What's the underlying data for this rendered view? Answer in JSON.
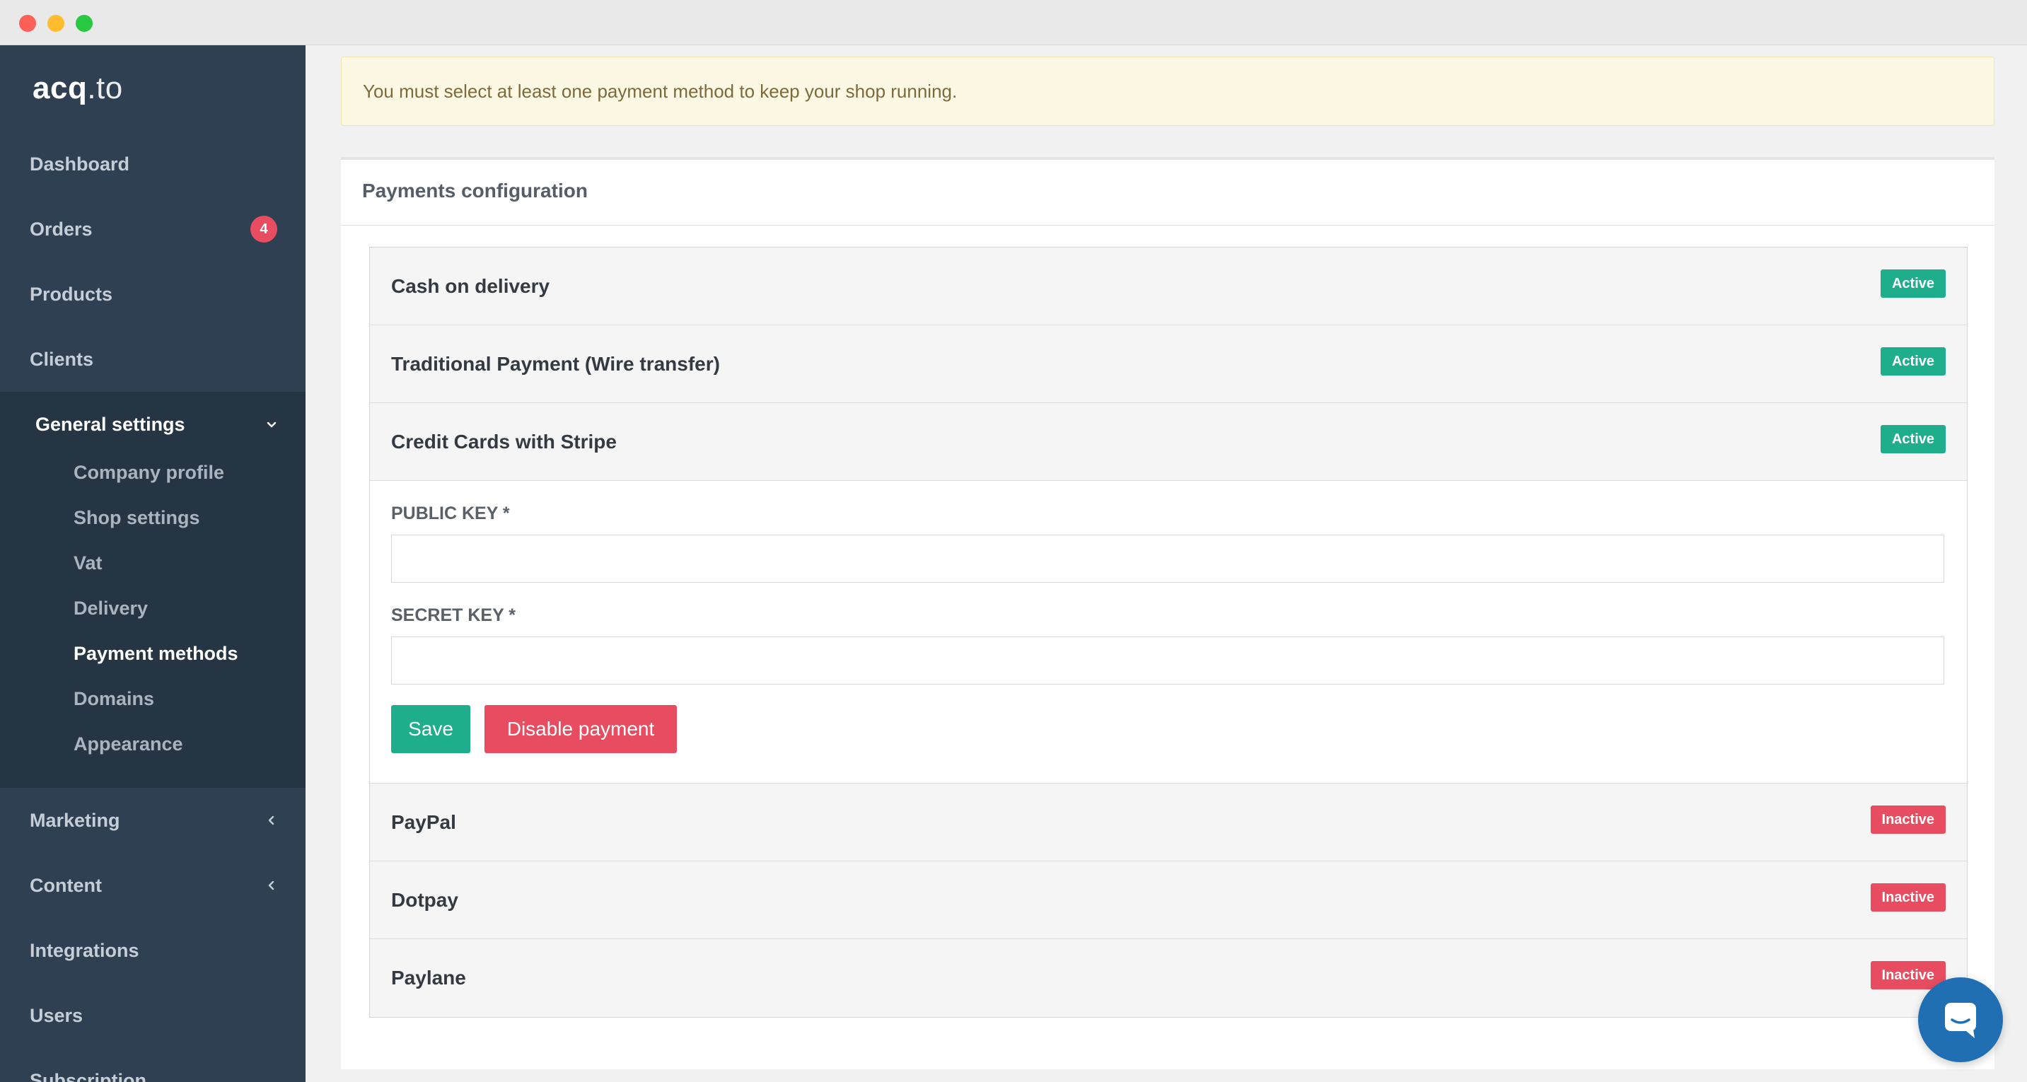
{
  "app": {
    "logo_bold": "acq",
    "logo_rest": ".to"
  },
  "sidebar": {
    "items": [
      {
        "label": "Dashboard"
      },
      {
        "label": "Orders",
        "badge": "4"
      },
      {
        "label": "Products"
      },
      {
        "label": "Clients"
      },
      {
        "label": "General settings",
        "expanded": true,
        "children": [
          {
            "label": "Company profile"
          },
          {
            "label": "Shop settings"
          },
          {
            "label": "Vat"
          },
          {
            "label": "Delivery"
          },
          {
            "label": "Payment methods",
            "active": true
          },
          {
            "label": "Domains"
          },
          {
            "label": "Appearance"
          }
        ]
      },
      {
        "label": "Marketing"
      },
      {
        "label": "Content"
      },
      {
        "label": "Integrations"
      },
      {
        "label": "Users"
      },
      {
        "label": "Subscription"
      }
    ]
  },
  "alert": {
    "text": "You must select at least one payment method to keep your shop running."
  },
  "payments": {
    "title": "Payments configuration",
    "methods": [
      {
        "name": "Cash on delivery",
        "status": "Active"
      },
      {
        "name": "Traditional Payment (Wire transfer)",
        "status": "Active"
      },
      {
        "name": "Credit Cards with Stripe",
        "status": "Active"
      },
      {
        "name": "PayPal",
        "status": "Inactive"
      },
      {
        "name": "Dotpay",
        "status": "Inactive"
      },
      {
        "name": "Paylane",
        "status": "Inactive"
      }
    ],
    "stripe_form": {
      "public_key_label": "PUBLIC KEY *",
      "public_key_value": "",
      "secret_key_label": "SECRET KEY *",
      "secret_key_value": "",
      "save_label": "Save",
      "disable_label": "Disable payment"
    }
  },
  "colors": {
    "sidebar_bg": "#2f4052",
    "sidebar_open_bg": "#263544",
    "active_green": "#1fae8c",
    "inactive_red": "#e84c61",
    "chat_blue": "#1f6fb2"
  },
  "icons": {
    "orders_badge": "count-badge",
    "general_settings_toggle": "chevron-down-icon",
    "marketing_toggle": "chevron-left-icon",
    "content_toggle": "chevron-left-icon",
    "chat": "chat-bubble-icon"
  }
}
